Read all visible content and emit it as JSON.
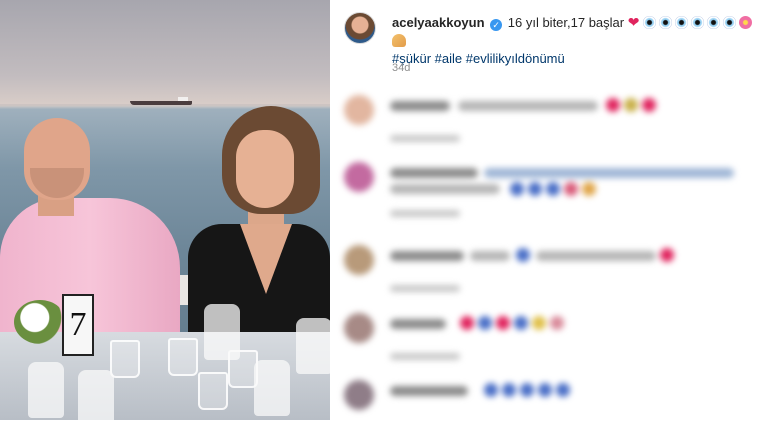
{
  "photo": {
    "table_number": "7"
  },
  "post": {
    "username": "acelyaakkoyun",
    "verified_mark": "✓",
    "caption_text": "16 yıl biter,17 başlar",
    "heart": "❤",
    "hashtags": [
      "#şükür",
      "#aile",
      "#evlilikyıldönümü"
    ],
    "time": "34d"
  },
  "colors": {
    "hashtag": "#00376b",
    "verified": "#3897f0",
    "muted": "#8e8e8e"
  },
  "icons": [
    "verified-badge-icon",
    "red-heart-icon",
    "evil-eye-icon",
    "hibiscus-icon",
    "praying-hands-icon",
    "like-heart-icon"
  ]
}
